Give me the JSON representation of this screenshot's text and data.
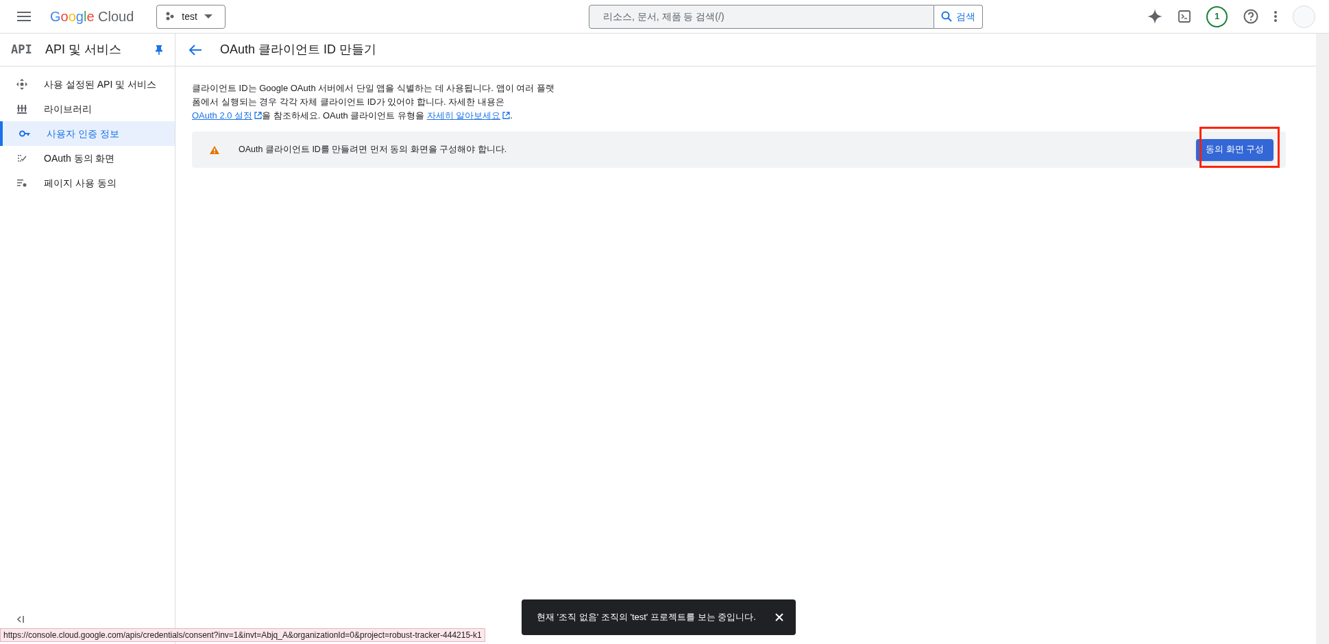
{
  "top_bar": {
    "product": "Google Cloud",
    "project": "test",
    "search": {
      "placeholder": "리소스, 문서, 제품 등 검색(/)",
      "button": "검색"
    },
    "notification_count": "1"
  },
  "sidebar": {
    "logo": "API",
    "title": "API 및 서비스",
    "items": [
      {
        "kind": "apis",
        "label": "사용 설정된 API 및 서비스",
        "selected": false
      },
      {
        "kind": "library",
        "label": "라이브러리",
        "selected": false
      },
      {
        "kind": "key",
        "label": "사용자 인증 정보",
        "selected": true
      },
      {
        "kind": "consent",
        "label": "OAuth 동의 화면",
        "selected": false
      },
      {
        "kind": "agreement",
        "label": "페이지 사용 동의",
        "selected": false
      }
    ]
  },
  "page": {
    "title": "OAuth 클라이언트 ID 만들기",
    "description": [
      {
        "kind": "text",
        "text": "클라이언트 ID는 Google OAuth 서버에서 단일 앱을 식별하는 데 사용됩니다. 앱이 여러 플랫폼에서 실행되는 경우 각각 자체 클라이언트 ID가 있어야 합니다. 자세한 내용은 "
      },
      {
        "kind": "link",
        "text": "OAuth 2.0 설정"
      },
      {
        "kind": "text",
        "text": "을 참조하세요. OAuth 클라이언트 유형을 "
      },
      {
        "kind": "link",
        "text": "자세히 알아보세요"
      },
      {
        "kind": "text",
        "text": "."
      }
    ],
    "alert": {
      "message": "OAuth 클라이언트 ID를 만들려면 먼저 동의 화면을 구성해야 합니다.",
      "button": "동의 화면 구성",
      "highlighted": true
    }
  },
  "toast": {
    "message": "현재 '조직 없음' 조직의 'test' 프로젝트를 보는 중입니다."
  },
  "status_url": "https://console.cloud.google.com/apis/credentials/consent?inv=1&invt=Abjq_A&organizationId=0&project=robust-tracker-444215-k1"
}
